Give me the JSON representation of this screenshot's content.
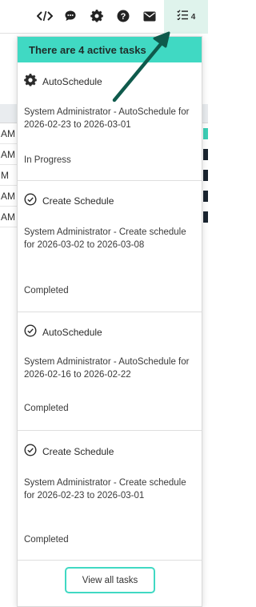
{
  "toolbar": {
    "icons": [
      "code-icon",
      "chat-icon",
      "gear-icon",
      "help-icon",
      "mail-icon",
      "tasks-icon"
    ],
    "task_count": "4"
  },
  "background": {
    "row_times": [
      "AM",
      "AM",
      "M",
      "AM",
      "AM"
    ]
  },
  "panel": {
    "header": "There are 4 active tasks",
    "tasks": [
      {
        "icon": "gear-icon",
        "title": "AutoSchedule",
        "description": "System Administrator - AutoSchedule for 2026-02-23 to 2026-03-01",
        "status": "In Progress"
      },
      {
        "icon": "check-circle-icon",
        "title": "Create Schedule",
        "description": "System Administrator - Create schedule for 2026-03-02 to 2026-03-08",
        "status": "Completed"
      },
      {
        "icon": "check-circle-icon",
        "title": "AutoSchedule",
        "description": "System Administrator - AutoSchedule for 2026-02-16 to 2026-02-22",
        "status": "Completed"
      },
      {
        "icon": "check-circle-icon",
        "title": "Create Schedule",
        "description": "System Administrator - Create schedule for 2026-02-23 to 2026-03-01",
        "status": "Completed"
      }
    ],
    "view_all_label": "View all tasks"
  },
  "colors": {
    "accent": "#40d9c3",
    "tasks_button_bg": "#dff3ec",
    "arrow": "#0f5a4c"
  }
}
